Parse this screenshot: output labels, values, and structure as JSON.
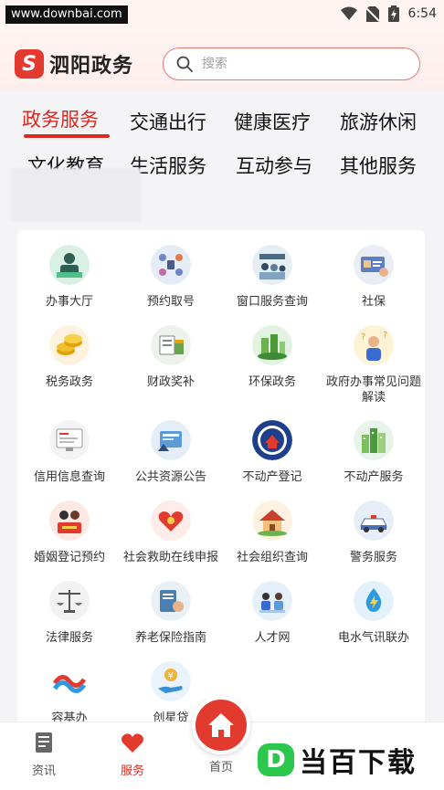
{
  "status_bar": {
    "url_watermark": "www.downbai.com",
    "time": "6:54",
    "icons": [
      "wifi-icon",
      "no-sim-icon",
      "battery-icon"
    ]
  },
  "header": {
    "app_name": "泗阳政务",
    "search_placeholder": "搜索",
    "accent_color": "#d62b21"
  },
  "tabs": [
    {
      "label": "政务服务",
      "active": true
    },
    {
      "label": "交通出行",
      "active": false
    },
    {
      "label": "健康医疗",
      "active": false
    },
    {
      "label": "旅游休闲",
      "active": false
    },
    {
      "label": "文化教育",
      "active": false
    },
    {
      "label": "生活服务",
      "active": false
    },
    {
      "label": "互动参与",
      "active": false
    },
    {
      "label": "其他服务",
      "active": false
    }
  ],
  "services": [
    {
      "label": "办事大厅",
      "icon": "service-hall-icon"
    },
    {
      "label": "预约取号",
      "icon": "appointment-icon"
    },
    {
      "label": "窗口服务查询",
      "icon": "window-service-icon"
    },
    {
      "label": "社保",
      "icon": "social-security-icon"
    },
    {
      "label": "税务政务",
      "icon": "tax-coins-icon"
    },
    {
      "label": "财政奖补",
      "icon": "finance-icon"
    },
    {
      "label": "环保政务",
      "icon": "environment-icon"
    },
    {
      "label": "政府办事常见问题解读",
      "icon": "faq-person-icon"
    },
    {
      "label": "信用信息查询",
      "icon": "credit-screen-icon"
    },
    {
      "label": "公共资源公告",
      "icon": "public-resource-icon"
    },
    {
      "label": "不动产登记",
      "icon": "real-estate-seal-icon"
    },
    {
      "label": "不动产服务",
      "icon": "buildings-icon"
    },
    {
      "label": "婚姻登记预约",
      "icon": "marriage-icon"
    },
    {
      "label": "社会救助在线申报",
      "icon": "social-aid-icon"
    },
    {
      "label": "社会组织查询",
      "icon": "house-icon"
    },
    {
      "label": "警务服务",
      "icon": "police-car-icon"
    },
    {
      "label": "法律服务",
      "icon": "scales-icon"
    },
    {
      "label": "养老保险指南",
      "icon": "pension-icon"
    },
    {
      "label": "人才网",
      "icon": "talent-icon"
    },
    {
      "label": "电水气讯联办",
      "icon": "utility-drop-icon"
    },
    {
      "label": "容基办",
      "icon": "ribbon-logo-icon"
    },
    {
      "label": "创星贷",
      "icon": "loan-hand-icon"
    }
  ],
  "bottom_nav": [
    {
      "label": "资讯",
      "icon": "news-icon",
      "active": false
    },
    {
      "label": "服务",
      "icon": "heart-icon",
      "active": true
    },
    {
      "label": "首页",
      "icon": "home-icon",
      "active": false
    }
  ],
  "brand_watermark": {
    "letter": "D",
    "text": "当百下载"
  }
}
